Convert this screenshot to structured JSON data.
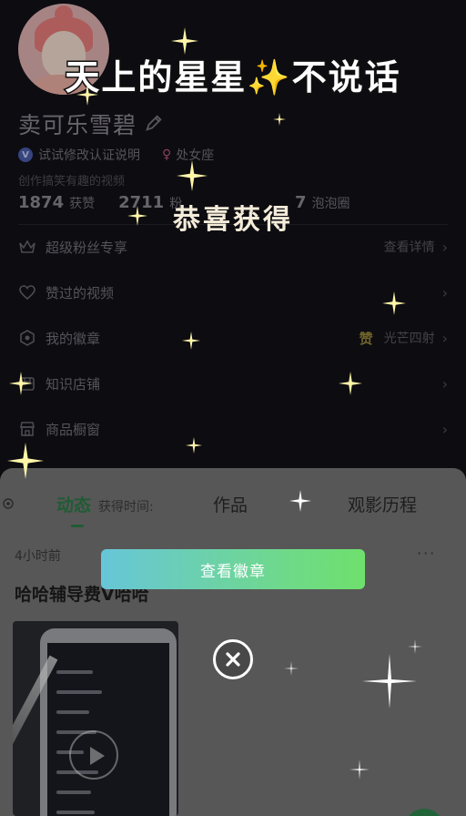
{
  "overlay": {
    "banner_title": "天上的星星✨不说话",
    "congrats": "恭喜获得",
    "obtain_time_label": "获得时间:",
    "view_badge_button": "查看徽章",
    "close_icon": "close-icon"
  },
  "profile": {
    "username": "卖可乐雪碧",
    "verify_text": "试试修改认证说明",
    "verify_badge": "V",
    "zodiac": "处女座",
    "bio": "创作搞笑有趣的视频",
    "stats": [
      {
        "value": "1874",
        "label": "获赞"
      },
      {
        "value": "2711",
        "label": "粉"
      }
    ],
    "stat_extra": {
      "value": "7",
      "label": "泡泡圈"
    }
  },
  "menu": [
    {
      "label": "超级粉丝专享",
      "right": "查看详情",
      "icon": "crown-icon"
    },
    {
      "label": "赞过的视频",
      "right": "",
      "icon": "heart-icon"
    },
    {
      "label": "我的徽章",
      "right": "光芒四射",
      "badge": "赞",
      "icon": "badge-icon"
    },
    {
      "label": "知识店铺",
      "right": "",
      "icon": "store-icon"
    },
    {
      "label": "商品橱窗",
      "right": "",
      "icon": "shop-window-icon"
    }
  ],
  "tabs": [
    {
      "label": "动态",
      "active": true
    },
    {
      "label": "作品",
      "active": false
    },
    {
      "label": "观影历程",
      "active": false
    }
  ],
  "post": {
    "time": "4小时前",
    "title": "哈哈辅导费V哈哈",
    "more": "···"
  },
  "colors": {
    "accent_green": "#2f7f4a",
    "button_gradient_start": "#67c6d8",
    "button_gradient_end": "#6ee06c",
    "sparkle": "#fff6a8"
  }
}
